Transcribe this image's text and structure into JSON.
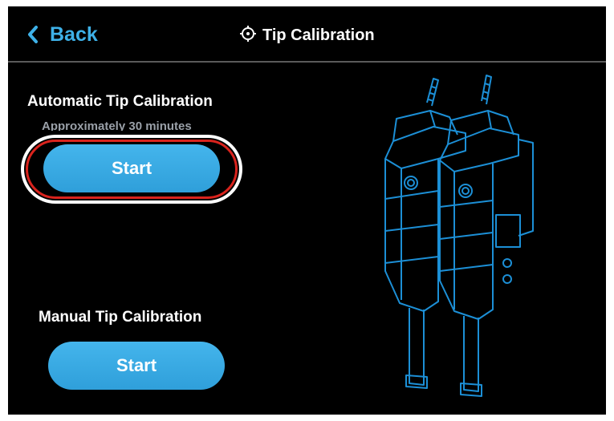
{
  "header": {
    "back_label": "Back",
    "back_icon": "chevron-left-icon",
    "title": "Tip Calibration",
    "title_icon": "calibration-target-icon"
  },
  "automatic": {
    "title": "Automatic Tip Calibration",
    "subtitle": "Approximately 30 minutes",
    "start_label": "Start",
    "highlighted": true
  },
  "manual": {
    "title": "Manual Tip Calibration",
    "start_label": "Start"
  },
  "illustration": {
    "icon": "dual-extruder-nozzle-illustration"
  },
  "colors": {
    "accent": "#3eb1e8",
    "button": "#38a9e2",
    "highlight": "#d9231d",
    "background": "#000000",
    "line_art": "#1c8fd6"
  }
}
